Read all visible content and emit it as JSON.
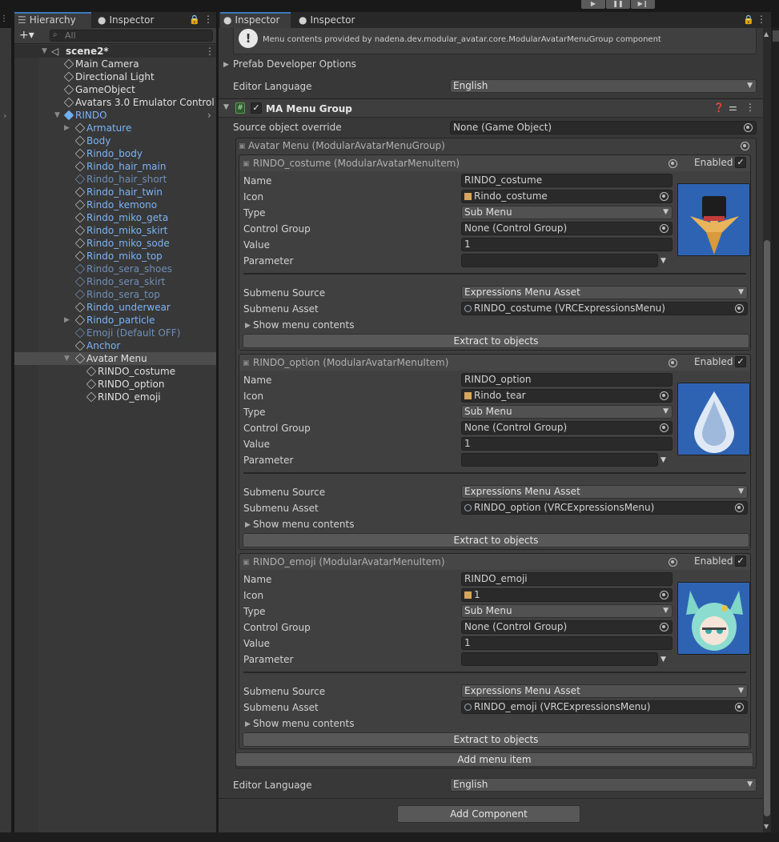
{
  "hierarchy": {
    "tab_hierarchy": "Hierarchy",
    "tab_inspector": "Inspector",
    "search_placeholder": "All",
    "scene": "scene2*",
    "rows": [
      {
        "label": "Main Camera"
      },
      {
        "label": "Directional Light"
      },
      {
        "label": "GameObject"
      },
      {
        "label": "Avatars 3.0 Emulator Control"
      },
      {
        "label": "RINDO"
      },
      {
        "label": "Armature"
      },
      {
        "label": "Body"
      },
      {
        "label": "Rindo_body"
      },
      {
        "label": "Rindo_hair_main"
      },
      {
        "label": "Rindo_hair_short"
      },
      {
        "label": "Rindo_hair_twin"
      },
      {
        "label": "Rindo_kemono"
      },
      {
        "label": "Rindo_miko_geta"
      },
      {
        "label": "Rindo_miko_skirt"
      },
      {
        "label": "Rindo_miko_sode"
      },
      {
        "label": "Rindo_miko_top"
      },
      {
        "label": "Rindo_sera_shoes"
      },
      {
        "label": "Rindo_sera_skirt"
      },
      {
        "label": "Rindo_sera_top"
      },
      {
        "label": "Rindo_underwear"
      },
      {
        "label": "Rindo_particle"
      },
      {
        "label": "Emoji (Default OFF)"
      },
      {
        "label": "Anchor"
      },
      {
        "label": "Avatar Menu"
      },
      {
        "label": "RINDO_costume"
      },
      {
        "label": "RINDO_option"
      },
      {
        "label": "RINDO_emoji"
      }
    ]
  },
  "inspector": {
    "tab1": "Inspector",
    "tab2": "Inspector",
    "info_text": "Menu contents provided by nadena.dev.modular_avatar.core.ModularAvatarMenuGroup component",
    "prefab_options": "Prefab Developer Options",
    "editor_language_label": "Editor Language",
    "editor_language_value": "English",
    "component_title": "MA Menu Group",
    "source_override_label": "Source object override",
    "source_override_value": "None (Game Object)",
    "group_title": "Avatar Menu (ModularAvatarMenuGroup)",
    "labels": {
      "name": "Name",
      "icon": "Icon",
      "type": "Type",
      "control_group": "Control Group",
      "value": "Value",
      "parameter": "Parameter",
      "submenu_source": "Submenu Source",
      "submenu_asset": "Submenu Asset",
      "show_contents": "Show menu contents",
      "extract": "Extract to objects",
      "enabled": "Enabled"
    },
    "items": [
      {
        "title": "RINDO_costume (ModularAvatarMenuItem)",
        "name": "RINDO_costume",
        "icon": "Rindo_costume",
        "type": "Sub Menu",
        "control_group": "None (Control Group)",
        "value": "1",
        "parameter": "",
        "submenu_source": "Expressions Menu Asset",
        "submenu_asset": "RINDO_costume (VRCExpressionsMenu)"
      },
      {
        "title": "RINDO_option (ModularAvatarMenuItem)",
        "name": "RINDO_option",
        "icon": "Rindo_tear",
        "type": "Sub Menu",
        "control_group": "None (Control Group)",
        "value": "1",
        "parameter": "",
        "submenu_source": "Expressions Menu Asset",
        "submenu_asset": "RINDO_option (VRCExpressionsMenu)"
      },
      {
        "title": "RINDO_emoji (ModularAvatarMenuItem)",
        "name": "RINDO_emoji",
        "icon": "1",
        "type": "Sub Menu",
        "control_group": "None (Control Group)",
        "value": "1",
        "parameter": "",
        "submenu_source": "Expressions Menu Asset",
        "submenu_asset": "RINDO_emoji (VRCExpressionsMenu)"
      }
    ],
    "add_menu_item": "Add menu item",
    "add_component": "Add Component"
  },
  "colors": {
    "accent": "#3a79bb",
    "prefab_blue": "#7cb3f5",
    "bg": "#383838"
  }
}
